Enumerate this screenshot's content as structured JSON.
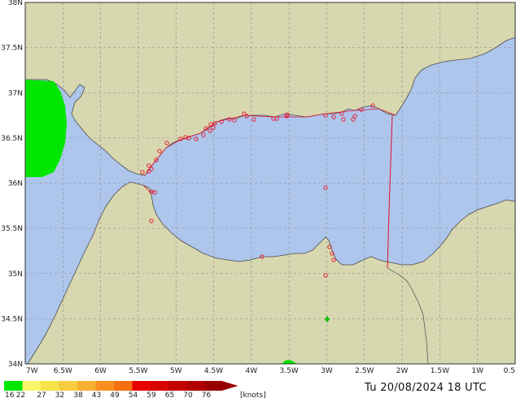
{
  "map": {
    "lat_ticks": [
      "38N",
      "37.5N",
      "37N",
      "36.5N",
      "36N",
      "35.5N",
      "35N",
      "34.5N",
      "34N"
    ],
    "lon_ticks": [
      "7W",
      "6.5W",
      "6W",
      "5.5W",
      "5W",
      "4.5W",
      "4W",
      "3.5W",
      "3W",
      "2.5W",
      "2W",
      "1.5W",
      "1W",
      "0.5"
    ],
    "lat_range": [
      34,
      38
    ],
    "lon_range": [
      -7,
      -0.5
    ],
    "colors": {
      "sea": "#aec6ec",
      "land": "#d7d7b0",
      "coast": "#4a4a4a",
      "grid": "#8a8a8a",
      "wind_area": "#00e600",
      "station": "#e8102a",
      "border": "#e01030"
    }
  },
  "legend": {
    "values": [
      "16",
      "22",
      "27",
      "32",
      "38",
      "43",
      "49",
      "54",
      "59",
      "65",
      "70",
      "76"
    ],
    "unit": "[knots]",
    "colors": [
      "#00e600",
      "#f7f76a",
      "#f7e24a",
      "#f7cc40",
      "#f7b030",
      "#f79020",
      "#f77010",
      "#e80000",
      "#d80000",
      "#c40000",
      "#b00000",
      "#980000"
    ]
  },
  "timestamp": "Tu 20/08/2024 18 UTC"
}
